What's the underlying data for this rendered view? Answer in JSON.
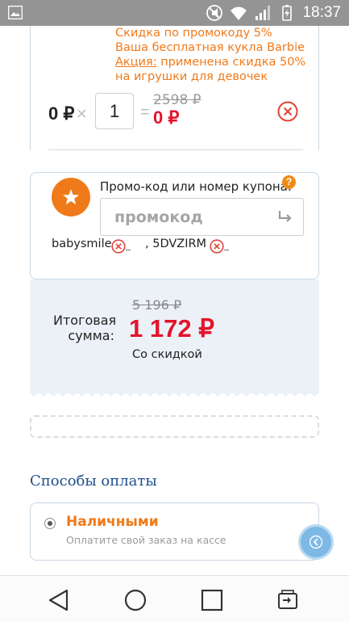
{
  "status_bar": {
    "time": "18:37",
    "icons": [
      "image-icon",
      "mute-icon",
      "wifi-icon",
      "signal-icon",
      "battery-charging-icon"
    ]
  },
  "cart_item": {
    "promo_note_line1": "Скидка по промокоду 5%",
    "promo_note_line2": "Ваша бесплатная кукла Barbie",
    "promo_note_action_label": "Акция:",
    "promo_note_action_text_1": " применена скидка 50%",
    "promo_note_action_text_2": "на игрушки для девочек",
    "unit_price": "0 ₽",
    "times_sign": "×",
    "quantity": "1",
    "equals_sign": "=",
    "old_price": "2598 ₽",
    "new_price": "0 ₽"
  },
  "promo": {
    "label": "Промо-код или номер купона:",
    "help_glyph": "?",
    "placeholder": "промокод",
    "applied_codes": [
      {
        "code": "babysmile"
      },
      {
        "code": ", 5DVZIRM"
      }
    ]
  },
  "total": {
    "label_line1": "Итоговая",
    "label_line2": "сумма:",
    "old_amount": "5 196 ₽",
    "new_amount": "1 172 ₽",
    "note": "Со скидкой"
  },
  "payment": {
    "section_title": "Способы оплаты",
    "options": [
      {
        "title": "Наличными",
        "subtitle": "Оплатите свой заказ на кассе",
        "selected": true
      }
    ]
  },
  "nav_bar": {
    "buttons": [
      "back-icon",
      "home-icon",
      "recents-icon",
      "switch-sim-icon"
    ]
  },
  "colors": {
    "accent_orange": "#f07a1a",
    "price_red": "#e2142b",
    "heading_blue": "#1e4f8b",
    "card_border": "#c9d7e4",
    "total_bg": "#ecf1f7",
    "status_bar_bg": "#949494"
  }
}
